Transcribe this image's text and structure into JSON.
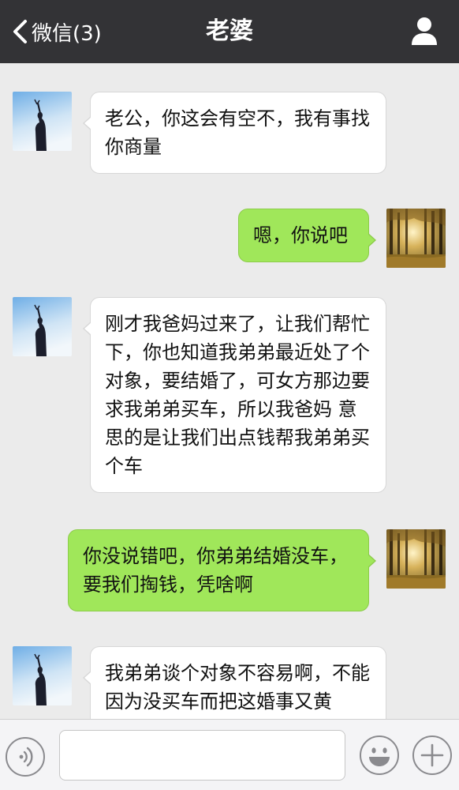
{
  "header": {
    "back_label": "微信(3)",
    "title": "老婆",
    "back_icon": "chevron-left-icon",
    "profile_icon": "person-icon"
  },
  "colors": {
    "header_bg": "#333336",
    "chat_bg": "#ebebeb",
    "sent_bubble": "#a0e75a",
    "received_bubble": "#ffffff"
  },
  "messages": [
    {
      "sender": "contact",
      "text": "老公，你这会有空不，我有事找你商量",
      "avatar": "sky-silhouette-avatar"
    },
    {
      "sender": "me",
      "text": "嗯，你说吧",
      "avatar": "forest-avatar"
    },
    {
      "sender": "contact",
      "text": "刚才我爸妈过来了，让我们帮忙下，你也知道我弟弟最近处了个对象，要结婚了，可女方那边要求我弟弟买车，所以我爸妈 意思的是让我们出点钱帮我弟弟买个车",
      "avatar": "sky-silhouette-avatar"
    },
    {
      "sender": "me",
      "text": "你没说错吧，你弟弟结婚没车，要我们掏钱，凭啥啊",
      "avatar": "forest-avatar"
    },
    {
      "sender": "contact",
      "text": "我弟弟谈个对象不容易啊，不能因为没买车而把这婚事又黄",
      "avatar": "sky-silhouette-avatar"
    }
  ],
  "footer": {
    "input_value": "",
    "voice_icon": "voice-icon",
    "emoji_icon": "emoji-icon",
    "plus_icon": "plus-icon"
  }
}
